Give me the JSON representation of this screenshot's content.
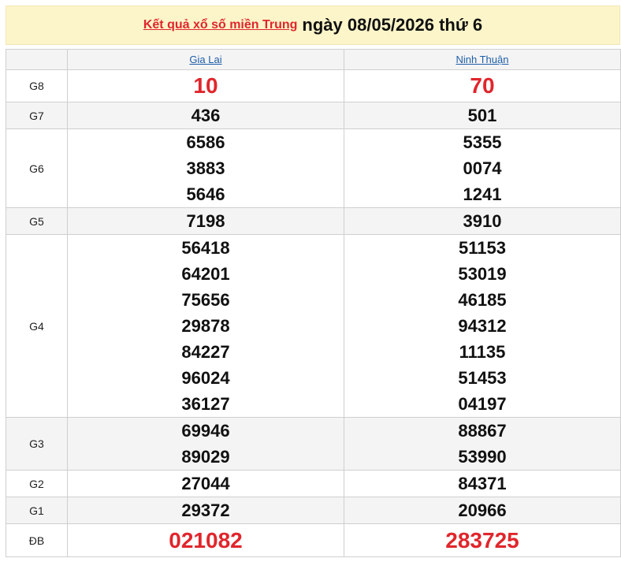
{
  "title": {
    "link_text": "Kết quả xổ số miền Trung",
    "date_text": "ngày 08/05/2026 thứ 6"
  },
  "provinces": [
    "Gia Lai",
    "Ninh Thuận"
  ],
  "prizes": {
    "g8": {
      "label": "G8",
      "values": [
        [
          "10"
        ],
        [
          "70"
        ]
      ]
    },
    "g7": {
      "label": "G7",
      "values": [
        [
          "436"
        ],
        [
          "501"
        ]
      ]
    },
    "g6": {
      "label": "G6",
      "values": [
        [
          "6586",
          "3883",
          "5646"
        ],
        [
          "5355",
          "0074",
          "1241"
        ]
      ]
    },
    "g5": {
      "label": "G5",
      "values": [
        [
          "7198"
        ],
        [
          "3910"
        ]
      ]
    },
    "g4": {
      "label": "G4",
      "values": [
        [
          "56418",
          "64201",
          "75656",
          "29878",
          "84227",
          "96024",
          "36127"
        ],
        [
          "51153",
          "53019",
          "46185",
          "94312",
          "11135",
          "51453",
          "04197"
        ]
      ]
    },
    "g3": {
      "label": "G3",
      "values": [
        [
          "69946",
          "89029"
        ],
        [
          "88867",
          "53990"
        ]
      ]
    },
    "g2": {
      "label": "G2",
      "values": [
        [
          "27044"
        ],
        [
          "84371"
        ]
      ]
    },
    "g1": {
      "label": "G1",
      "values": [
        [
          "29372"
        ],
        [
          "20966"
        ]
      ]
    },
    "db": {
      "label": "ĐB",
      "values": [
        [
          "021082"
        ],
        [
          "283725"
        ]
      ]
    }
  },
  "colors": {
    "accent_red": "#e0262c",
    "link_blue": "#1f5ea8",
    "title_bg": "#fcf5c9",
    "alt_row_bg": "#f4f4f4"
  }
}
